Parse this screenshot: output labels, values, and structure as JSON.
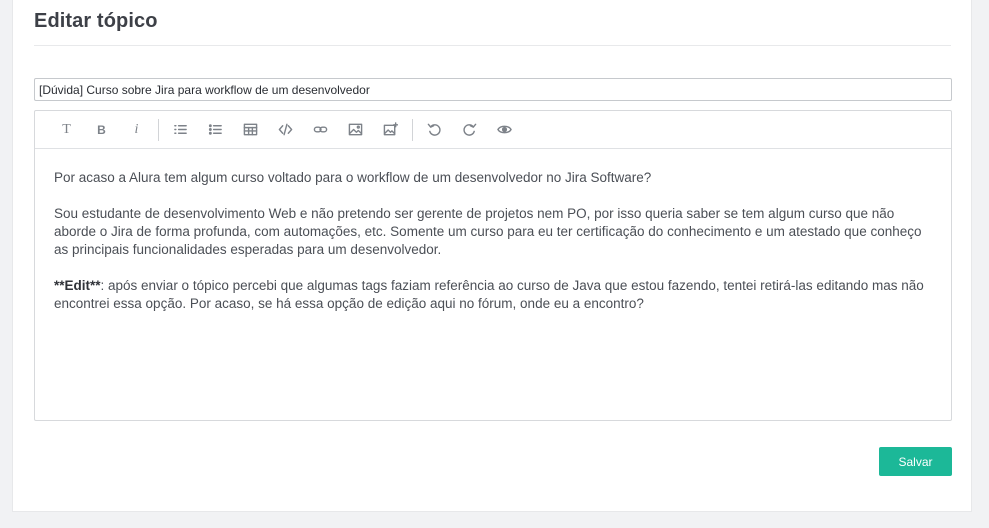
{
  "page": {
    "title": "Editar tópico"
  },
  "topic": {
    "title_value": "[Dúvida] Curso sobre Jira para workflow de um desenvolvedor"
  },
  "toolbar": {
    "heading_label": "T",
    "bold_label": "B",
    "italic_label": "i",
    "icons": [
      "heading-icon",
      "bold-icon",
      "italic-icon",
      "ordered-list-icon",
      "bullet-list-icon",
      "table-icon",
      "code-icon",
      "link-icon",
      "image-icon",
      "image-upload-icon",
      "undo-icon",
      "redo-icon",
      "preview-icon"
    ]
  },
  "body": {
    "paragraph_1": "Por acaso a Alura tem algum curso voltado para o workflow de um desenvolvedor no Jira Software?",
    "paragraph_2": "Sou estudante de desenvolvimento Web e não pretendo ser gerente de projetos nem PO, por isso queria saber se tem algum curso que não aborde o Jira de forma profunda, com automações, etc. Somente um curso para eu ter certificação do conhecimento e um atestado que conheço as principais funcionalidades esperadas para um desenvolvedor.",
    "paragraph_3_bold": "**Edit**",
    "paragraph_3_rest": ": após enviar o tópico percebi que algumas tags faziam referência ao curso de Java que estou fazendo, tentei retirá-las editando mas não encontrei essa opção. Por acaso, se há essa opção de edição aqui no fórum, onde eu a encontro?"
  },
  "actions": {
    "save_label": "Salvar"
  },
  "colors": {
    "accent": "#1cb898",
    "background": "#f1f2f4"
  }
}
